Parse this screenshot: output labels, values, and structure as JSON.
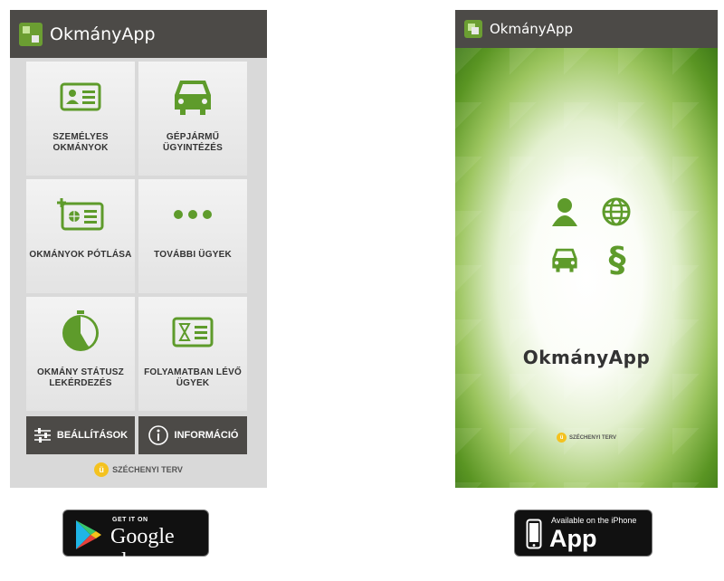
{
  "left_screen": {
    "app_title": "OkmányApp",
    "tiles": [
      {
        "label": "SZEMÉLYES\nOKMÁNYOK",
        "icon": "id-card-icon"
      },
      {
        "label": "GÉPJÁRMŰ\nÜGYINTÉZÉS",
        "icon": "car-icon"
      },
      {
        "label": "OKMÁNYOK PÓTLÁSA",
        "icon": "add-card-icon"
      },
      {
        "label": "TOVÁBBI ÜGYEK",
        "icon": "more-dots-icon"
      },
      {
        "label": "OKMÁNY STÁTUSZ\nLEKÉRDEZÉS",
        "icon": "clock-icon"
      },
      {
        "label": "FOLYAMATBAN LÉVŐ\nÜGYEK",
        "icon": "hourglass-card-icon"
      }
    ],
    "settings_label": "BEÁLLÍTÁSOK",
    "info_label": "INFORMÁCIÓ",
    "footer": "SZÉCHENYI TERV"
  },
  "right_screen": {
    "app_title": "OkmányApp",
    "splash_title": "OkmányApp",
    "footer": "SZÉCHENYI TERV"
  },
  "badges": {
    "google_small": "GET IT ON",
    "google_big": "Google play",
    "apple_small": "Available on the iPhone",
    "apple_big": "App Store"
  },
  "colors": {
    "accent_green": "#5e9b2b",
    "appbar": "#4c4a47",
    "tile_bg": "#ececec"
  }
}
